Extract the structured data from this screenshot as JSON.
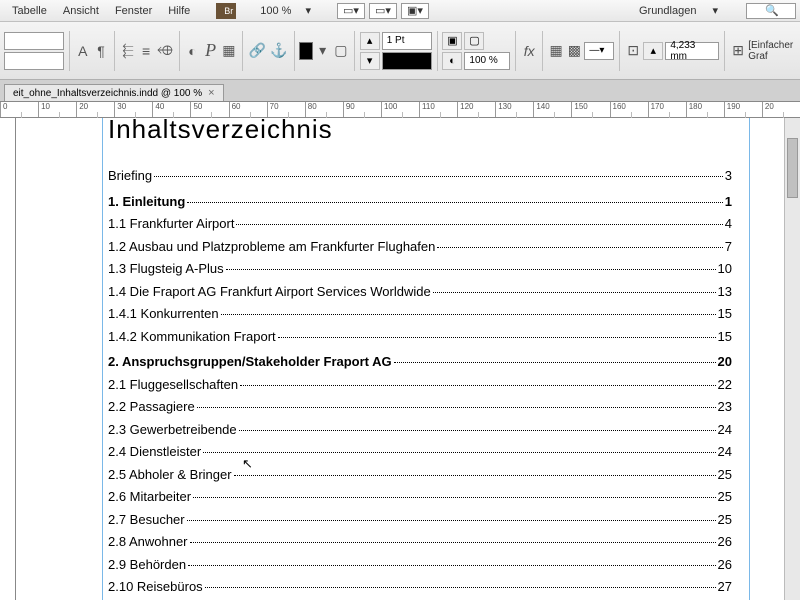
{
  "menu": {
    "items": [
      "Tabelle",
      "Ansicht",
      "Fenster",
      "Hilfe"
    ],
    "zoom": "100 %",
    "basics": "Grundlagen"
  },
  "toolbar": {
    "stroke": "1 Pt",
    "zoom2": "100 %",
    "measure": "4,233 mm",
    "frametool": "[Einfacher Graf"
  },
  "tab": {
    "name": "eit_ohne_Inhaltsverzeichnis.indd @ 100 %"
  },
  "ruler_ticks": [
    "0",
    "10",
    "20",
    "30",
    "40",
    "50",
    "60",
    "70",
    "80",
    "90",
    "100",
    "110",
    "120",
    "130",
    "140",
    "150",
    "160",
    "170",
    "180",
    "190",
    "20"
  ],
  "doc": {
    "title": "Inhaltsverzeichnis",
    "toc": [
      {
        "label": "Briefing",
        "page": "3",
        "bold": false
      },
      {
        "label": "1. Einleitung",
        "page": "1",
        "bold": true
      },
      {
        "label": "1.1 Frankfurter Airport",
        "page": "4",
        "bold": false
      },
      {
        "label": "1.2 Ausbau und Platzprobleme am Frankfurter Flughafen",
        "page": "7",
        "bold": false
      },
      {
        "label": "1.3 Flugsteig A-Plus",
        "page": "10",
        "bold": false
      },
      {
        "label": "1.4 Die Fraport AG Frankfurt Airport Services Worldwide",
        "page": "13",
        "bold": false
      },
      {
        "label": "1.4.1 Konkurrenten",
        "page": "15",
        "bold": false
      },
      {
        "label": "1.4.2 Kommunikation Fraport",
        "page": "15",
        "bold": false
      },
      {
        "label": "2. Anspruchsgruppen/Stakeholder Fraport AG",
        "page": "20",
        "bold": true
      },
      {
        "label": "2.1 Fluggesellschaften",
        "page": "22",
        "bold": false
      },
      {
        "label": "2.2 Passagiere",
        "page": "23",
        "bold": false
      },
      {
        "label": "2.3 Gewerbetreibende",
        "page": "24",
        "bold": false
      },
      {
        "label": "2.4 Dienstleister",
        "page": "24",
        "bold": false
      },
      {
        "label": "2.5 Abholer & Bringer",
        "page": "25",
        "bold": false
      },
      {
        "label": "2.6 Mitarbeiter",
        "page": "25",
        "bold": false
      },
      {
        "label": "2.7 Besucher",
        "page": "25",
        "bold": false
      },
      {
        "label": "2.8 Anwohner",
        "page": "26",
        "bold": false
      },
      {
        "label": "2.9 Behörden",
        "page": "26",
        "bold": false
      },
      {
        "label": "2.10 Reisebüros",
        "page": "27",
        "bold": false
      }
    ]
  }
}
